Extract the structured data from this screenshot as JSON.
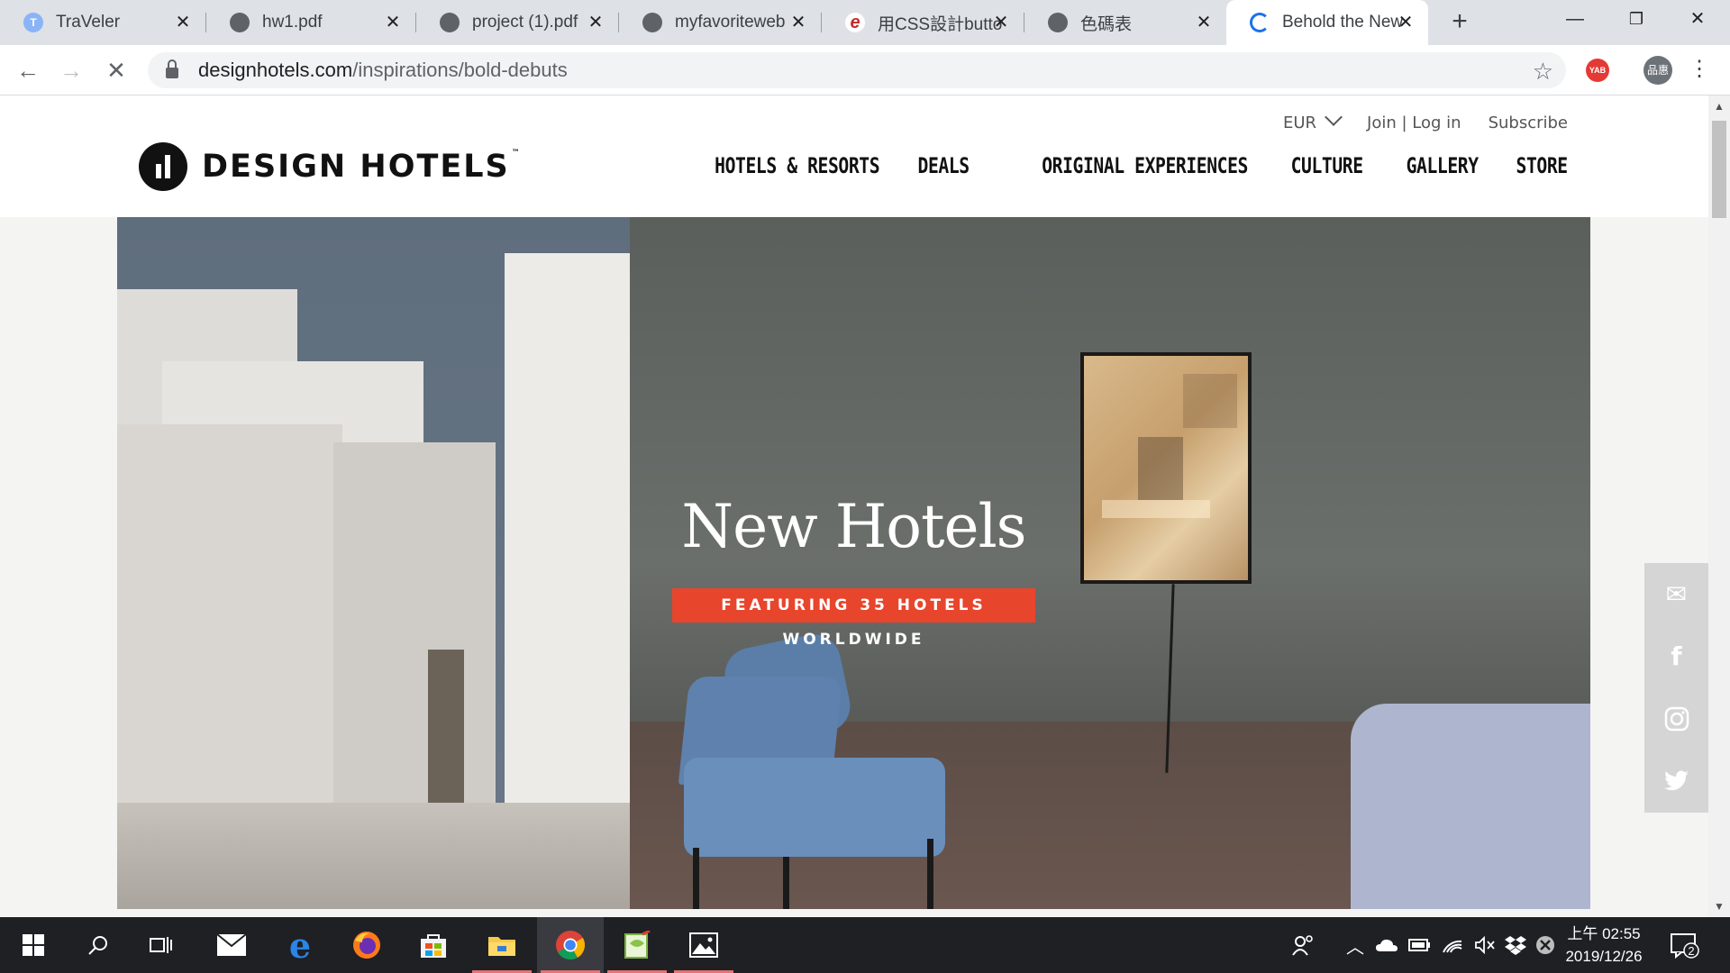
{
  "browser": {
    "tabs": [
      {
        "title": "TraVeler",
        "active": false
      },
      {
        "title": "hw1.pdf",
        "active": false
      },
      {
        "title": "project (1).pdf",
        "active": false
      },
      {
        "title": "myfavoriteweb",
        "active": false
      },
      {
        "title": "用CSS設計butto",
        "active": false
      },
      {
        "title": "色碼表",
        "active": false
      },
      {
        "title": "Behold the New",
        "active": true
      }
    ],
    "url_domain": "designhotels.com",
    "url_path": "/inspirations/bold-debuts",
    "profile_label": "品惠",
    "extension_label": "YAB",
    "colors": {
      "tabstrip": "#dee1e6",
      "accent": "#1a73e8"
    }
  },
  "site": {
    "utility": {
      "currency": "EUR",
      "login": "Join | Log in",
      "subscribe": "Subscribe"
    },
    "logo_text": "DESIGN HOTELS",
    "logo_tm": "™",
    "nav": [
      "HOTELS & RESORTS",
      "DEALS",
      "ORIGINAL EXPERIENCES",
      "CULTURE",
      "GALLERY",
      "STORE"
    ],
    "hero": {
      "title": "New Hotels",
      "badge": "FEATURING 35 HOTELS WORLDWIDE",
      "badge_color": "#e8452d"
    },
    "social": [
      "mail-icon",
      "facebook-icon",
      "instagram-icon",
      "twitter-icon"
    ]
  },
  "taskbar": {
    "clock_time": "上午 02:55",
    "clock_date": "2019/12/26",
    "notification_count": "2",
    "apps": [
      "start-icon",
      "search-icon",
      "task-view-icon",
      "mail-icon",
      "edge-icon",
      "firefox-icon",
      "store-icon",
      "file-explorer-icon",
      "chrome-icon",
      "notepad-icon",
      "photos-icon"
    ]
  }
}
